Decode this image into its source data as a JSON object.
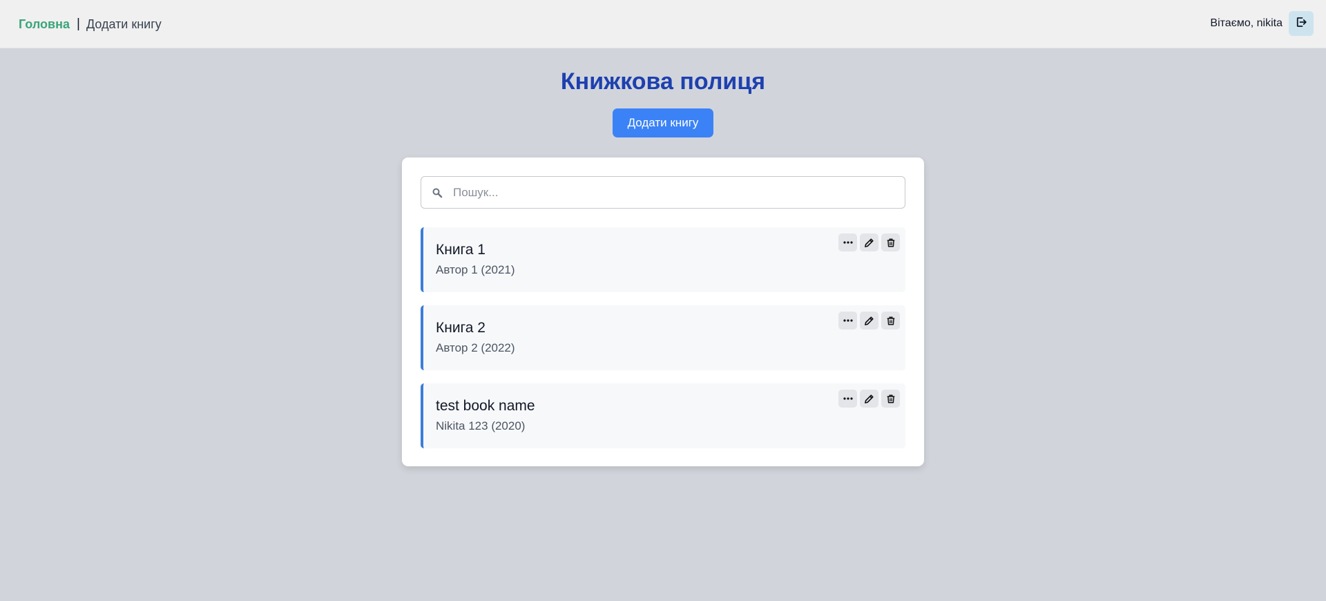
{
  "nav": {
    "home": "Головна",
    "separator": "|",
    "add_book": "Додати книгу"
  },
  "user": {
    "greeting": "Вітаємо, nikita",
    "logout_icon": "logout-icon"
  },
  "main": {
    "title": "Книжкова полиця",
    "add_button_label": "Додати книгу"
  },
  "search": {
    "placeholder": "Пошук...",
    "value": "",
    "icon": "search-icon"
  },
  "books": [
    {
      "title": "Книга 1",
      "meta": "Автор 1 (2021)"
    },
    {
      "title": "Книга 2",
      "meta": "Автор 2 (2022)"
    },
    {
      "title": "test book name",
      "meta": "Nikita 123 (2020)"
    }
  ],
  "book_actions": [
    "more-icon",
    "edit-icon",
    "delete-icon"
  ],
  "colors": {
    "background": "#d1d5db",
    "nav_home": "#3aa57a",
    "title": "#1e40af",
    "primary_button": "#3b82f6",
    "item_accent": "#3b7dd8"
  }
}
